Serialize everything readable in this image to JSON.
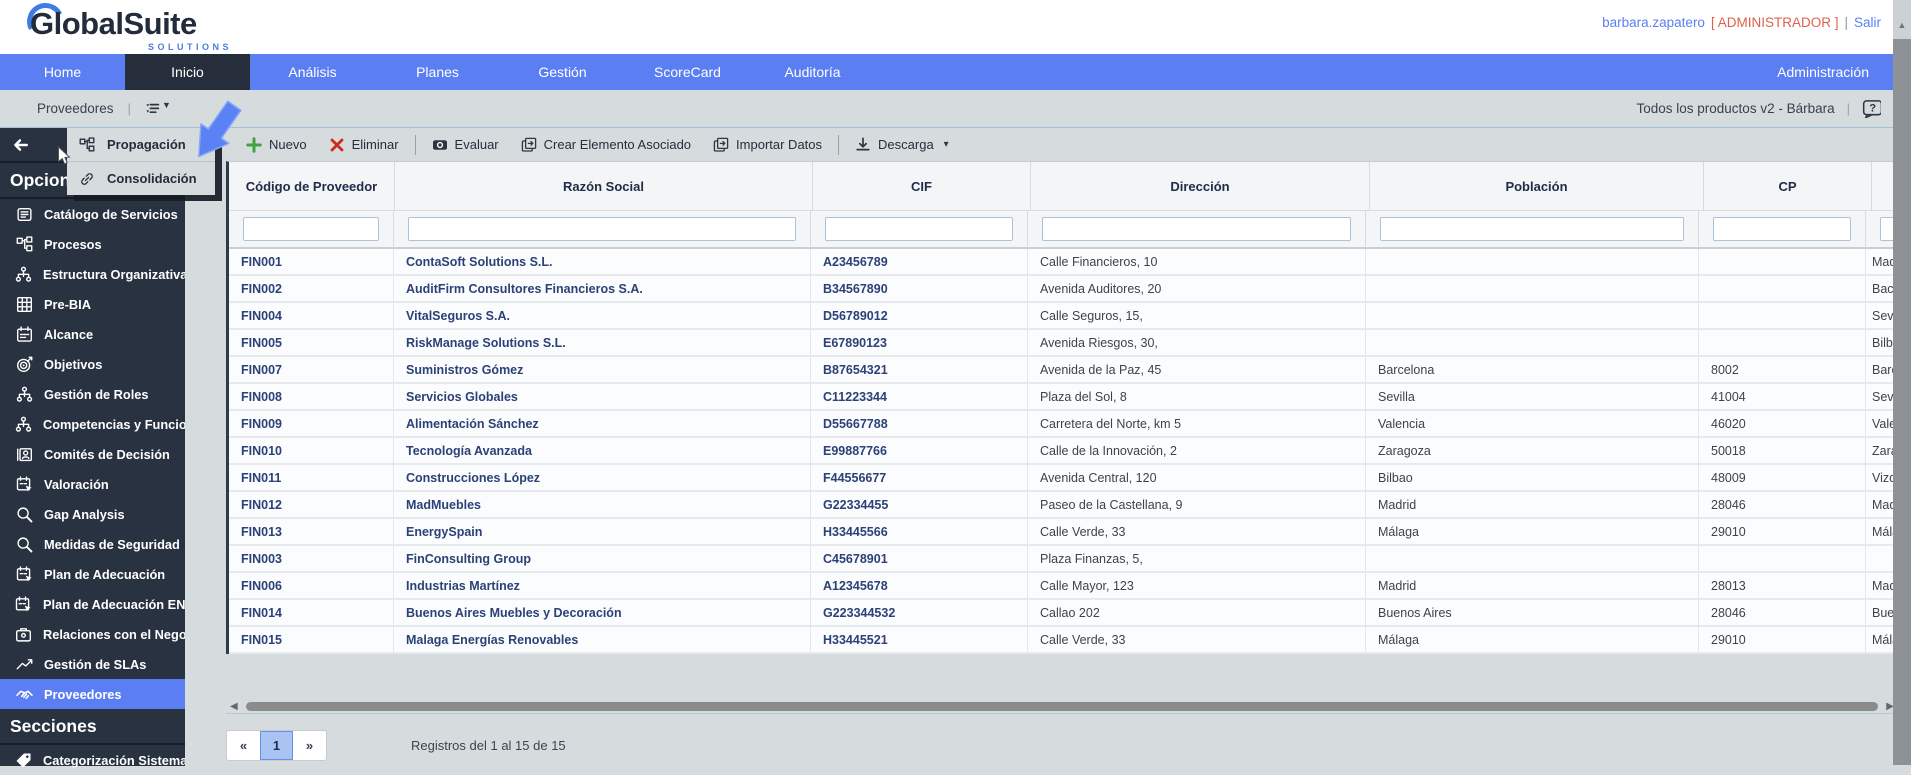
{
  "colors": {
    "accent": "#5b7ff2",
    "sidebar_dark": "#293241",
    "role_orange": "#e0614b",
    "link_navy": "#2c4178"
  },
  "header": {
    "logo_text": "GlobalSuite",
    "logo_sub": "SOLUTIONS",
    "user_name": "barbara.zapatero",
    "user_role": "[ ADMINISTRADOR ]",
    "user_sep": "|",
    "logout": "Salir"
  },
  "nav": {
    "items": [
      {
        "label": "Home"
      },
      {
        "label": "Inicio",
        "active": true
      },
      {
        "label": "Análisis"
      },
      {
        "label": "Planes"
      },
      {
        "label": "Gestión"
      },
      {
        "label": "ScoreCard"
      },
      {
        "label": "Auditoría"
      }
    ],
    "right": "Administración"
  },
  "breadcrumb": {
    "title": "Proveedores",
    "sep": "|",
    "context": "Todos los productos v2 - Bárbara",
    "context_sep": "|"
  },
  "context_menu": {
    "items": [
      {
        "icon": "hier",
        "label": "Propagación"
      },
      {
        "icon": "link",
        "label": "Consolidación"
      }
    ]
  },
  "sidebar": {
    "sections": [
      {
        "title": "Opciones",
        "items": [
          {
            "icon": "doc",
            "label": "Catálogo de Servicios"
          },
          {
            "icon": "hier",
            "label": "Procesos"
          },
          {
            "icon": "org",
            "label": "Estructura Organizativa"
          },
          {
            "icon": "grid",
            "label": "Pre-BIA"
          },
          {
            "icon": "cal",
            "label": "Alcance"
          },
          {
            "icon": "target",
            "label": "Objetivos"
          },
          {
            "icon": "org",
            "label": "Gestión de Roles"
          },
          {
            "icon": "org",
            "label": "Competencias y Funciones"
          },
          {
            "icon": "idcard",
            "label": "Comités de Decisión"
          },
          {
            "icon": "calcur",
            "label": "Valoración"
          },
          {
            "icon": "search",
            "label": "Gap Analysis"
          },
          {
            "icon": "search",
            "label": "Medidas de Seguridad"
          },
          {
            "icon": "calcur",
            "label": "Plan de Adecuación"
          },
          {
            "icon": "calcur",
            "label": "Plan de Adecuación ENS"
          },
          {
            "icon": "brief",
            "label": "Relaciones con el Negocio"
          },
          {
            "icon": "chart",
            "label": "Gestión de SLAs"
          },
          {
            "icon": "shake",
            "label": "Proveedores",
            "active": true
          }
        ]
      },
      {
        "title": "Secciones",
        "items": [
          {
            "icon": "tag",
            "label": "Categorización Sistema"
          }
        ]
      }
    ]
  },
  "toolbar": {
    "buttons": [
      {
        "icon": "plus",
        "label": "Nuevo"
      },
      {
        "icon": "xmark",
        "label": "Eliminar"
      },
      {
        "icon": "eval",
        "label": "Evaluar"
      },
      {
        "icon": "copy",
        "label": "Crear Elemento Asociado"
      },
      {
        "icon": "copy",
        "label": "Importar Datos"
      },
      {
        "icon": "down",
        "label": "Descarga",
        "caret": true
      }
    ]
  },
  "table": {
    "columns": [
      "Código de Proveedor",
      "Razón Social",
      "CIF",
      "Dirección",
      "Población",
      "CP",
      ""
    ],
    "rows": [
      [
        "FIN001",
        "ContaSoft Solutions S.L.",
        "A23456789",
        "Calle Financieros, 10",
        "",
        "",
        "Madrid"
      ],
      [
        "FIN002",
        "AuditFirm Consultores Financieros S.A.",
        "B34567890",
        "Avenida Auditores, 20",
        "",
        "",
        "Bacelona"
      ],
      [
        "FIN004",
        "VitalSeguros S.A.",
        "D56789012",
        "Calle Seguros, 15,",
        "",
        "",
        "Sevilla"
      ],
      [
        "FIN005",
        "RiskManage Solutions S.L.",
        "E67890123",
        "Avenida Riesgos, 30,",
        "",
        "",
        "Bilbao"
      ],
      [
        "FIN007",
        "Suministros Gómez",
        "B87654321",
        "Avenida de la Paz, 45",
        "Barcelona",
        "8002",
        "Barcelona"
      ],
      [
        "FIN008",
        "Servicios Globales",
        "C11223344",
        "Plaza del Sol, 8",
        "Sevilla",
        "41004",
        "Sevilla"
      ],
      [
        "FIN009",
        "Alimentación Sánchez",
        "D55667788",
        "Carretera del Norte, km 5",
        "Valencia",
        "46020",
        "Valencia"
      ],
      [
        "FIN010",
        "Tecnología Avanzada",
        "E99887766",
        "Calle de la Innovación, 2",
        "Zaragoza",
        "50018",
        "Zaragoza"
      ],
      [
        "FIN011",
        "Construcciones López",
        "F44556677",
        "Avenida Central, 120",
        "Bilbao",
        "48009",
        "Vizcaya"
      ],
      [
        "FIN012",
        "MadMuebles",
        "G22334455",
        "Paseo de la Castellana, 9",
        "Madrid",
        "28046",
        "Madrid"
      ],
      [
        "FIN013",
        "EnergySpain",
        "H33445566",
        "Calle Verde, 33",
        "Málaga",
        "29010",
        "Málaga"
      ],
      [
        "FIN003",
        "FinConsulting Group",
        "C45678901",
        "Plaza Finanzas, 5,",
        "",
        "",
        ""
      ],
      [
        "FIN006",
        "Industrias Martínez",
        "A12345678",
        "Calle Mayor, 123",
        "Madrid",
        "28013",
        "Madrid"
      ],
      [
        "FIN014",
        "Buenos Aires Muebles y Decoración",
        "G223344532",
        "Callao 202",
        "Buenos Aires",
        "28046",
        "Buenos Aires"
      ],
      [
        "FIN015",
        "Malaga Energías Renovables",
        "H33445521",
        "Calle Verde, 33",
        "Málaga",
        "29010",
        "Málaga"
      ]
    ]
  },
  "pagination": {
    "prev": "«",
    "current": "1",
    "next": "»",
    "summary": "Registros del 1 al 15 de 15"
  }
}
